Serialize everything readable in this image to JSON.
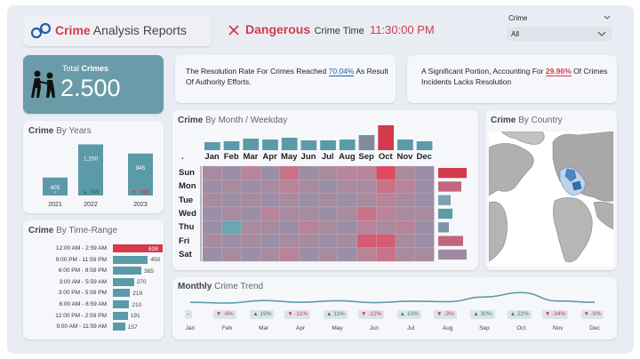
{
  "header": {
    "title_bold": "Crime",
    "title_rest": " Analysis Reports",
    "dangerous_label": "Dangerous",
    "crime_time_label": "Crime Time",
    "crime_time_value": "11:30:00 PM"
  },
  "filter": {
    "label": "Crime",
    "value": "All"
  },
  "total": {
    "label_a": "Total ",
    "label_b": "Crimes",
    "value": "2.500"
  },
  "info1": {
    "pre": "The Resolution Rate For Crimes Reached ",
    "pct": "70.04%",
    "post": " As Result Of Authority Efforts."
  },
  "info2": {
    "pre": "A Significant Portion, Accounting For ",
    "pct": "29.96%",
    "post": " Of Crimes Incidents Lacks Resolution"
  },
  "years_card": {
    "title_a": "Crime",
    "title_b": " By Years"
  },
  "time_card": {
    "title_a": "Crime",
    "title_b": " By Time-Range"
  },
  "heat_card": {
    "title_a": "Crime",
    "title_b": " By Month / Weekday",
    "corner_dot": "."
  },
  "country_card": {
    "title_a": "Crime",
    "title_b": " By Country"
  },
  "trend_card": {
    "title_a": "Monthly",
    "title_b": " Crime Trend"
  },
  "chart_data": [
    {
      "type": "bar",
      "title": "Crime By Years",
      "categories": [
        "2021",
        "2022",
        "2023"
      ],
      "values": [
        405,
        1150,
        945
      ],
      "value_labels": [
        "405",
        "1,150",
        "945"
      ],
      "changes": [
        "-",
        "▲ 745",
        "▼ -205"
      ],
      "ylim": [
        0,
        1200
      ]
    },
    {
      "type": "bar",
      "title": "Crime By Time-Range",
      "categories": [
        "12:00 AM - 2:59 AM",
        "9:00 PM - 11:59 PM",
        "6:00 PM - 8:59 PM",
        "3:00 AM - 5:59 AM",
        "3:00 PM - 5:59 PM",
        "6:00 AM - 8:59 AM",
        "12:00 PM - 2:59 PM",
        "9:00 AM - 11:59 AM"
      ],
      "values": [
        638,
        450,
        365,
        270,
        219,
        210,
        191,
        157
      ]
    },
    {
      "type": "heatmap",
      "title": "Crime By Month / Weekday",
      "months": [
        "Jan",
        "Feb",
        "Mar",
        "Apr",
        "May",
        "Jun",
        "Jul",
        "Aug",
        "Sep",
        "Oct",
        "Nov",
        "Dec"
      ],
      "month_totals": [
        195,
        200,
        215,
        210,
        220,
        205,
        205,
        210,
        235,
        290,
        210,
        200
      ],
      "weekdays": [
        "Sun",
        "Mon",
        "Tue",
        "Wed",
        "Thu",
        "Fri",
        "Sat"
      ],
      "weekday_totals": [
        380,
        365,
        335,
        340,
        330,
        370,
        380
      ],
      "cells": [
        [
          3,
          2,
          4,
          2,
          5,
          2,
          3,
          4,
          4,
          7,
          3,
          2
        ],
        [
          2,
          3,
          2,
          3,
          4,
          3,
          2,
          3,
          3,
          5,
          4,
          2
        ],
        [
          3,
          2,
          3,
          2,
          3,
          2,
          3,
          2,
          3,
          4,
          3,
          2
        ],
        [
          2,
          3,
          2,
          4,
          3,
          3,
          2,
          3,
          5,
          4,
          3,
          3
        ],
        [
          2,
          0,
          3,
          3,
          2,
          4,
          3,
          2,
          4,
          3,
          4,
          2
        ],
        [
          3,
          2,
          3,
          2,
          3,
          3,
          2,
          3,
          6,
          6,
          3,
          2
        ],
        [
          2,
          3,
          2,
          3,
          4,
          2,
          3,
          2,
          4,
          5,
          3,
          3
        ]
      ]
    },
    {
      "type": "line",
      "title": "Monthly Crime Trend",
      "categories": [
        "Jan",
        "Feb",
        "Mar",
        "Apr",
        "May",
        "Jun",
        "Jul",
        "Aug",
        "Sep",
        "Oct",
        "Nov",
        "Dec"
      ],
      "values": [
        195,
        184,
        218,
        194,
        215,
        190,
        209,
        203,
        264,
        322,
        212,
        194
      ],
      "changes": [
        "-",
        "▼ -6%",
        "▲ 19%",
        "▼ -11%",
        "▲ 11%",
        "▼ -12%",
        "▲ 10%",
        "▼ -3%",
        "▲ 30%",
        "▲ 22%",
        "▼ -34%",
        "▼ -9%"
      ]
    }
  ],
  "colors": {
    "accent_red": "#d43a4c",
    "teal": "#5b9aa8",
    "card_teal": "#6a9ba8"
  },
  "icons": {
    "logo": "handcuffs-icon",
    "total": "arrest-icon",
    "dangerous": "close-icon",
    "dropdown": "chevron-down-icon"
  }
}
